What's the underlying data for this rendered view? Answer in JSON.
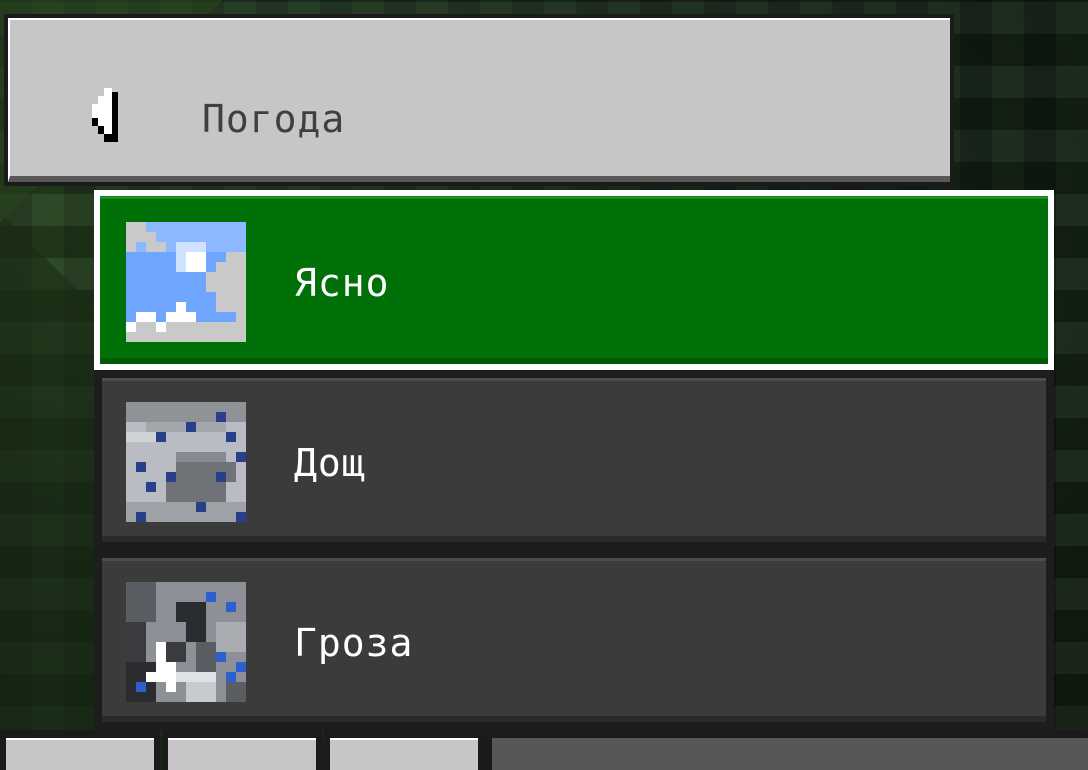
{
  "header": {
    "title": "Погода",
    "back_icon": "chevron-left-icon"
  },
  "weather_options": [
    {
      "label": "Ясно",
      "icon": "clear-weather-icon",
      "selected": true
    },
    {
      "label": "Дощ",
      "icon": "rain-weather-icon",
      "selected": false
    },
    {
      "label": "Гроза",
      "icon": "thunder-weather-icon",
      "selected": false
    }
  ],
  "colors": {
    "selected": "#007008",
    "button": "#3b3b3b",
    "header": "#c6c6c6"
  }
}
